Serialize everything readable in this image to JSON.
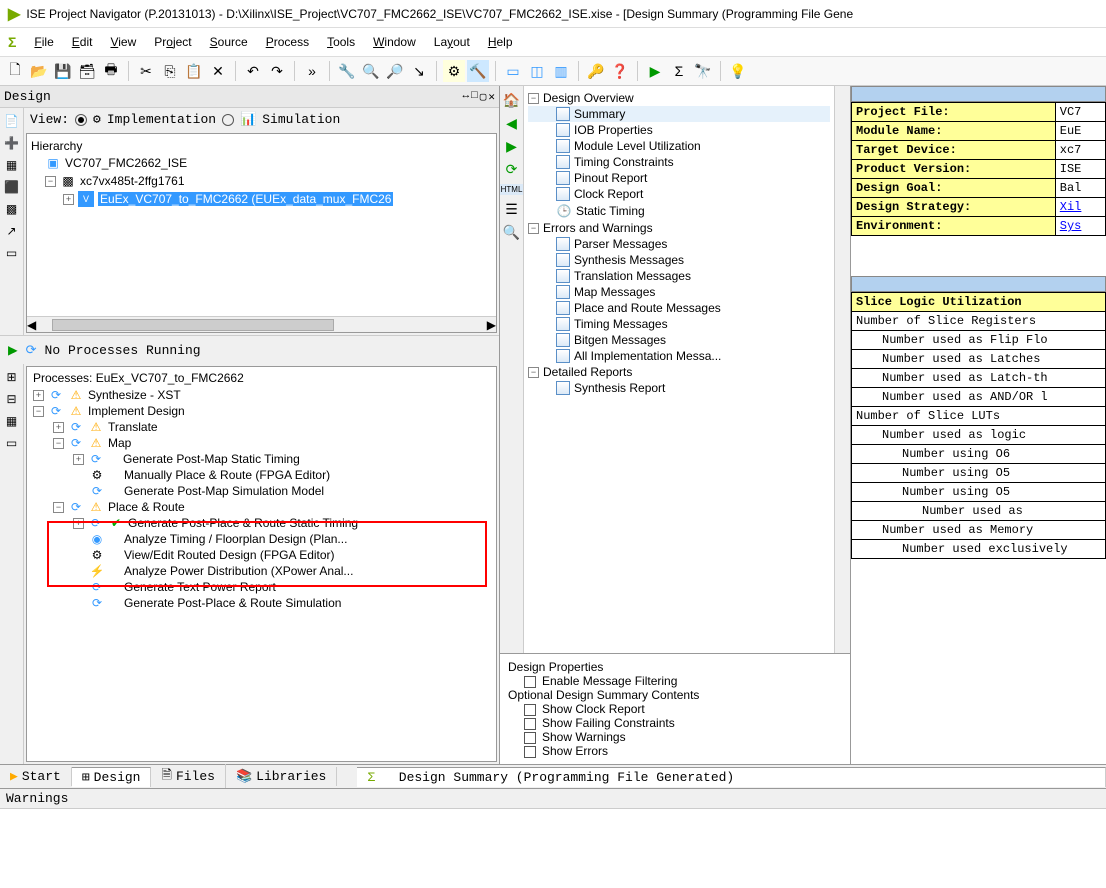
{
  "window": {
    "title": "ISE Project Navigator (P.20131013) - D:\\Xilinx\\ISE_Project\\VC707_FMC2662_ISE\\VC707_FMC2662_ISE.xise - [Design Summary (Programming File Gene"
  },
  "menu": [
    "File",
    "Edit",
    "View",
    "Project",
    "Source",
    "Process",
    "Tools",
    "Window",
    "Layout",
    "Help"
  ],
  "design_pane": {
    "title": "Design",
    "view_label": "View:",
    "impl": "Implementation",
    "sim": "Simulation",
    "hierarchy_label": "Hierarchy",
    "items": {
      "proj": "VC707_FMC2662_ISE",
      "device": "xc7vx485t-2ffg1761",
      "top": "EuEx_VC707_to_FMC2662 (EUEx_data_mux_FMC26"
    },
    "no_proc": "No Processes Running",
    "proc_header": "Processes: EuEx_VC707_to_FMC2662",
    "procs": {
      "synth": "Synthesize - XST",
      "impl": "Implement Design",
      "translate": "Translate",
      "map": "Map",
      "gpm_static": "Generate Post-Map Static Timing",
      "manual_pr": "Manually Place & Route (FPGA Editor)",
      "gpm_sim": "Generate Post-Map Simulation Model",
      "par": "Place & Route",
      "gppr_static": "Generate Post-Place & Route Static Timing",
      "analyze": "Analyze Timing / Floorplan Design (Plan...",
      "view_routed": "View/Edit Routed Design (FPGA Editor)",
      "xpower": "Analyze Power Distribution (XPower Anal...",
      "power_rpt": "Generate Text Power Report",
      "gppr_sim": "Generate Post-Place & Route Simulation"
    }
  },
  "overview": {
    "root": "Design Overview",
    "items": [
      "Summary",
      "IOB Properties",
      "Module Level Utilization",
      "Timing Constraints",
      "Pinout Report",
      "Clock Report",
      "Static Timing"
    ],
    "errs": "Errors and Warnings",
    "err_items": [
      "Parser Messages",
      "Synthesis Messages",
      "Translation Messages",
      "Map Messages",
      "Place and Route Messages",
      "Timing Messages",
      "Bitgen Messages",
      "All Implementation Messa..."
    ],
    "det": "Detailed Reports",
    "det_items": [
      "Synthesis Report"
    ]
  },
  "props": {
    "title": "Design Properties",
    "emf": "Enable Message Filtering",
    "opt": "Optional Design Summary Contents",
    "scr": "Show Clock Report",
    "sfc": "Show Failing Constraints",
    "sw": "Show Warnings",
    "se": "Show Errors"
  },
  "project_table": [
    [
      "Project File:",
      "VC7"
    ],
    [
      "Module Name:",
      "EuE"
    ],
    [
      "Target Device:",
      "xc7"
    ],
    [
      "Product Version:",
      "ISE"
    ],
    [
      "Design Goal:",
      "Bal"
    ],
    [
      "Design Strategy:",
      "Xil"
    ],
    [
      "Environment:",
      "Sys"
    ]
  ],
  "util_header": "Slice Logic Utilization",
  "util_rows": [
    "Number of Slice Registers",
    "Number used as Flip Flo",
    "Number used as Latches",
    "Number used as Latch-th",
    "Number used as AND/OR l",
    "Number of Slice LUTs",
    "Number used as logic",
    "Number using O6",
    "Number using O5",
    "Number using O5",
    "Number used as",
    "Number used as Memory",
    "Number used exclusively"
  ],
  "tabs": {
    "start": "Start",
    "design": "Design",
    "files": "Files",
    "libs": "Libraries"
  },
  "status_tab": "Design Summary (Programming File Generated)",
  "console": "Warnings"
}
